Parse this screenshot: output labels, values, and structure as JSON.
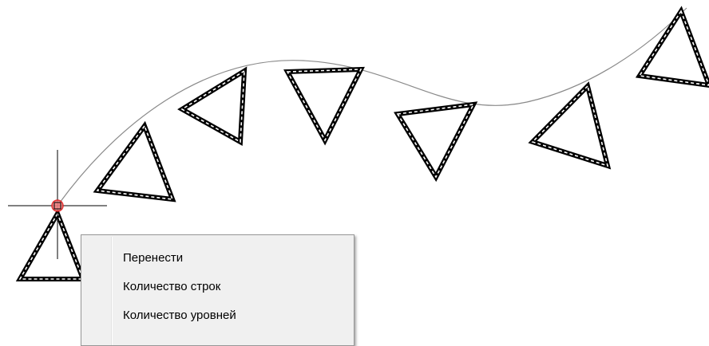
{
  "context_menu": {
    "items": [
      {
        "label": "Перенести"
      },
      {
        "label": "Количество строк"
      },
      {
        "label": "Количество уровней"
      }
    ]
  },
  "colors": {
    "background": "#ffffff",
    "curve": "#8a8a8a",
    "triangle_stroke": "#000000",
    "crosshair": "#000000",
    "grip_marker": "#e02020",
    "menu_background": "#f0f0f0",
    "menu_border": "#979797"
  },
  "icons": {
    "cursor": "crosshair-icon",
    "grip": "base-point-grip-icon"
  }
}
